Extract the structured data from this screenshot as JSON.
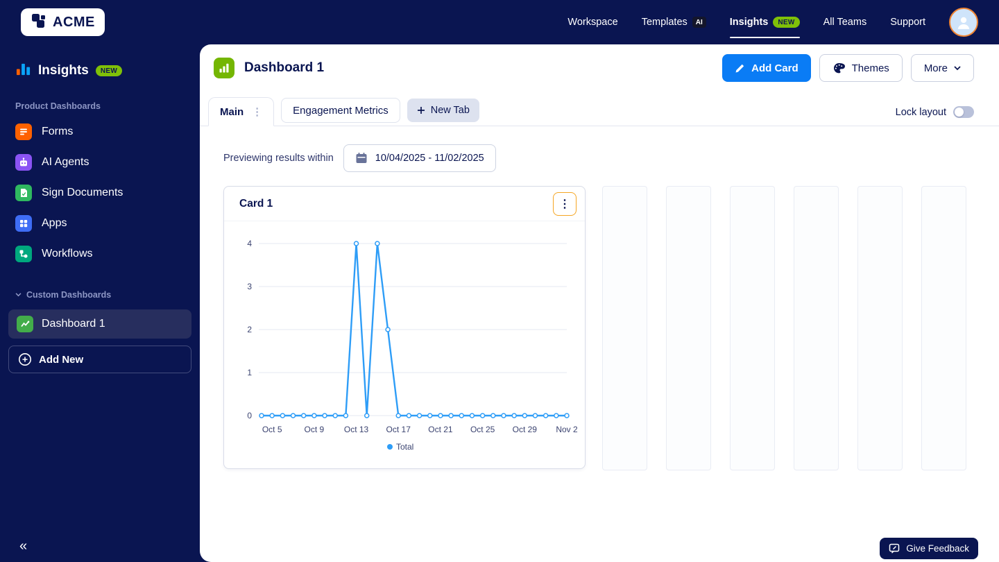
{
  "colors": {
    "navy": "#0a1551",
    "accent_blue": "#0a7cf5",
    "badge_green": "#7fc008",
    "chart_blue": "#2e9df7",
    "kebab_focus_orange": "#f5a623"
  },
  "topbar": {
    "logo_text": "ACME",
    "nav": [
      {
        "label": "Workspace"
      },
      {
        "label": "Templates",
        "badge": "AI"
      },
      {
        "label": "Insights",
        "badge": "NEW"
      },
      {
        "label": "All Teams"
      },
      {
        "label": "Support"
      }
    ]
  },
  "sidebar": {
    "title": "Insights",
    "title_badge": "NEW",
    "product_section_label": "Product Dashboards",
    "product_items": [
      {
        "label": "Forms"
      },
      {
        "label": "AI Agents"
      },
      {
        "label": "Sign Documents"
      },
      {
        "label": "Apps"
      },
      {
        "label": "Workflows"
      }
    ],
    "custom_section_label": "Custom Dashboards",
    "custom_items": [
      {
        "label": "Dashboard 1"
      }
    ],
    "add_new_label": "Add New",
    "collapse_glyph": "«"
  },
  "main": {
    "title": "Dashboard 1",
    "add_card_label": "Add Card",
    "themes_label": "Themes",
    "more_label": "More",
    "tabs": [
      {
        "label": "Main"
      },
      {
        "label": "Engagement Metrics"
      }
    ],
    "new_tab_label": "New Tab",
    "lock_layout_label": "Lock layout",
    "preview_label": "Previewing results within",
    "date_range": "10/04/2025 - 11/02/2025",
    "card_title": "Card 1",
    "feedback_label": "Give Feedback"
  },
  "chart_data": {
    "type": "line",
    "title": "Card 1",
    "x": [
      "Oct 4",
      "Oct 5",
      "Oct 6",
      "Oct 7",
      "Oct 8",
      "Oct 9",
      "Oct 10",
      "Oct 11",
      "Oct 12",
      "Oct 13",
      "Oct 14",
      "Oct 15",
      "Oct 16",
      "Oct 17",
      "Oct 18",
      "Oct 19",
      "Oct 20",
      "Oct 21",
      "Oct 22",
      "Oct 23",
      "Oct 24",
      "Oct 25",
      "Oct 26",
      "Oct 27",
      "Oct 28",
      "Oct 29",
      "Oct 30",
      "Oct 31",
      "Nov 1",
      "Nov 2"
    ],
    "x_tick_labels": [
      "Oct 5",
      "Oct 9",
      "Oct 13",
      "Oct 17",
      "Oct 21",
      "Oct 25",
      "Oct 29",
      "Nov 2"
    ],
    "series": [
      {
        "name": "Total",
        "values": [
          0,
          0,
          0,
          0,
          0,
          0,
          0,
          0,
          0,
          4,
          0,
          4,
          2,
          0,
          0,
          0,
          0,
          0,
          0,
          0,
          0,
          0,
          0,
          0,
          0,
          0,
          0,
          0,
          0,
          0
        ]
      }
    ],
    "ylim": [
      0,
      4
    ],
    "yticks": [
      0,
      1,
      2,
      3,
      4
    ],
    "grid": true,
    "legend_position": "bottom",
    "line_color": "#2e9df7"
  }
}
